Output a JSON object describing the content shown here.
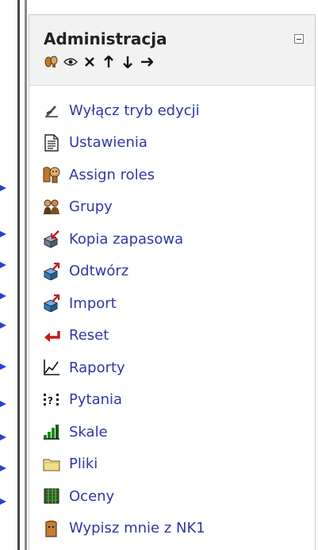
{
  "block": {
    "title": "Administracja",
    "controls": [
      {
        "icon": "assign-roles-icon"
      },
      {
        "icon": "eye-icon"
      },
      {
        "icon": "delete-x-icon"
      },
      {
        "icon": "arrow-up-icon"
      },
      {
        "icon": "arrow-down-icon"
      },
      {
        "icon": "arrow-right-icon"
      }
    ],
    "items": [
      {
        "label": "Wyłącz tryb edycji",
        "icon": "edit-pen-icon"
      },
      {
        "label": "Ustawienia",
        "icon": "settings-document-icon"
      },
      {
        "label": "Assign roles",
        "icon": "assign-roles-icon"
      },
      {
        "label": "Grupy",
        "icon": "groups-icon"
      },
      {
        "label": "Kopia zapasowa",
        "icon": "backup-box-icon"
      },
      {
        "label": "Odtwórz",
        "icon": "restore-box-icon"
      },
      {
        "label": "Import",
        "icon": "import-box-icon"
      },
      {
        "label": "Reset",
        "icon": "reset-arrow-icon"
      },
      {
        "label": "Raporty",
        "icon": "reports-chart-icon"
      },
      {
        "label": "Pytania",
        "icon": "questions-icon"
      },
      {
        "label": "Skale",
        "icon": "scales-bars-icon"
      },
      {
        "label": "Pliki",
        "icon": "folder-icon"
      },
      {
        "label": "Oceny",
        "icon": "grades-grid-icon"
      },
      {
        "label": "Wypisz mnie z NK1",
        "icon": "unenrol-icon"
      }
    ]
  },
  "colors": {
    "link": "#2c39a8",
    "header_bg": "#f2f2f2",
    "arrow": "#2b3fd6"
  }
}
